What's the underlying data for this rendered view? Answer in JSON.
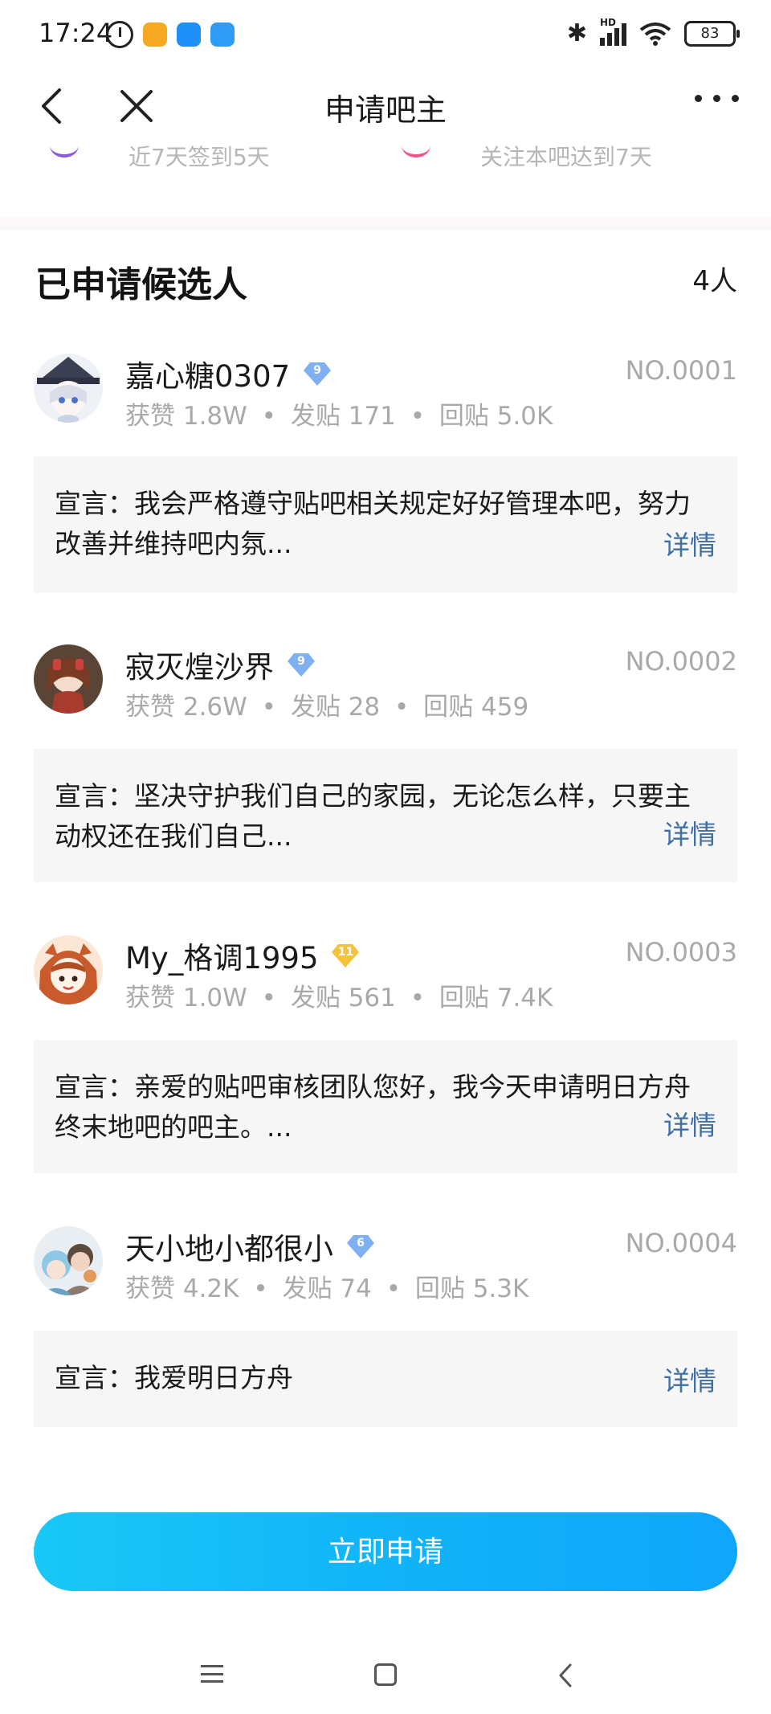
{
  "status_bar": {
    "time": "17:24",
    "network": "HD",
    "battery": "83"
  },
  "nav": {
    "title": "申请吧主"
  },
  "prev_section": {
    "items": [
      "近7天签到5天",
      "关注本吧达到7天"
    ]
  },
  "section": {
    "title": "已申请候选人",
    "count": "4人"
  },
  "stats_labels": {
    "likes": "获赞",
    "posts": "发贴",
    "replies": "回贴",
    "separator": "•"
  },
  "declaration_prefix": "宣言：",
  "detail_label": "详情",
  "candidates": [
    {
      "name": "嘉心糖0307",
      "level": "9",
      "badge_color": "#7fb0f2",
      "number": "NO.0001",
      "likes": "1.8W",
      "posts": "171",
      "replies": "5.0K",
      "declaration": "我会严格遵守贴吧相关规定好好管理本吧，努力改善并维持吧内氛..."
    },
    {
      "name": "寂灭煌沙界",
      "level": "9",
      "badge_color": "#7fb0f2",
      "number": "NO.0002",
      "likes": "2.6W",
      "posts": "28",
      "replies": "459",
      "declaration": "坚决守护我们自己的家园，无论怎么样，只要主动权还在我们自己..."
    },
    {
      "name": "My_格调1995",
      "level": "11",
      "badge_color": "#f4c23b",
      "number": "NO.0003",
      "likes": "1.0W",
      "posts": "561",
      "replies": "7.4K",
      "declaration": "亲爱的贴吧审核团队您好，我今天申请明日方舟终末地吧的吧主。..."
    },
    {
      "name": "天小地小都很小",
      "level": "6",
      "badge_color": "#7fb0f2",
      "number": "NO.0004",
      "likes": "4.2K",
      "posts": "74",
      "replies": "5.3K",
      "declaration": "我爱明日方舟"
    }
  ],
  "apply_button": "立即申请"
}
